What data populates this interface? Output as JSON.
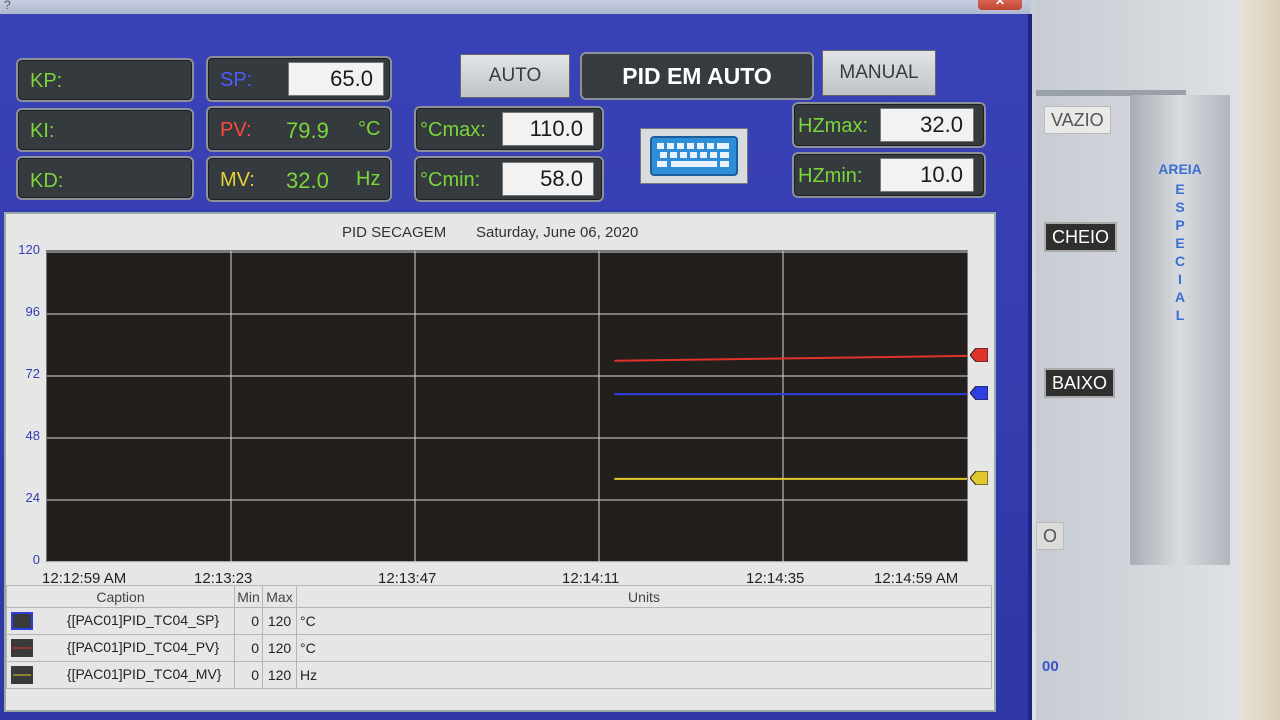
{
  "window": {
    "title_mark": "?",
    "close_glyph": "✕"
  },
  "controls": {
    "kp_label": "KP:",
    "ki_label": "KI:",
    "kd_label": "KD:",
    "sp_label": "SP:",
    "sp_value": "65.0",
    "pv_label": "PV:",
    "pv_value": "79.9",
    "pv_unit": "°C",
    "mv_label": "MV:",
    "mv_value": "32.0",
    "mv_unit": "Hz",
    "cmax_label": "°Cmax:",
    "cmax_value": "110.0",
    "cmin_label": "°Cmin:",
    "cmin_value": "58.0",
    "hzmax_label": "HZmax:",
    "hzmax_value": "32.0",
    "hzmin_label": "HZmin:",
    "hzmin_value": "10.0",
    "auto_button": "AUTO",
    "mode_status": "PID EM AUTO",
    "manual_button": "MANUAL",
    "keyboard_icon": "keyboard-icon"
  },
  "trend": {
    "title": "PID SECAGEM",
    "date": "Saturday, June 06, 2020",
    "legend_headers": {
      "caption": "Caption",
      "min": "Min",
      "max": "Max",
      "units": "Units"
    },
    "legend_rows": [
      {
        "caption": "{[PAC01]PID_TC04_SP}",
        "min": "0",
        "max": "120",
        "unit": "°C",
        "color": "#2d3fe0"
      },
      {
        "caption": "{[PAC01]PID_TC04_PV}",
        "min": "0",
        "max": "120",
        "unit": "°C",
        "color": "#e0332b"
      },
      {
        "caption": "{[PAC01]PID_TC04_MV}",
        "min": "0",
        "max": "120",
        "unit": "Hz",
        "color": "#e0c82b"
      }
    ]
  },
  "chart_data": {
    "type": "line",
    "title": "PID SECAGEM",
    "subtitle": "Saturday, June 06, 2020",
    "y_ticks": [
      "120",
      "96",
      "72",
      "48",
      "24",
      "0"
    ],
    "x_ticks": [
      "12:12:59 AM",
      "12:13:23",
      "12:13:47",
      "12:14:11",
      "12:14:35",
      "12:14:59 AM"
    ],
    "ylim": [
      0,
      120
    ],
    "xlim": [
      "12:12:59",
      "12:14:59"
    ],
    "grid": true,
    "series": [
      {
        "name": "{[PAC01]PID_TC04_PV}",
        "color": "#e0332b",
        "x": [
          "12:14:13",
          "12:14:59"
        ],
        "values": [
          78,
          79.9
        ]
      },
      {
        "name": "{[PAC01]PID_TC04_SP}",
        "color": "#2d3fe0",
        "x": [
          "12:14:13",
          "12:14:59"
        ],
        "values": [
          65,
          65
        ]
      },
      {
        "name": "{[PAC01]PID_TC04_MV}",
        "color": "#e0c82b",
        "x": [
          "12:14:13",
          "12:14:59"
        ],
        "values": [
          32,
          32
        ]
      }
    ]
  },
  "side": {
    "vazio": "VAZIO",
    "cheio": "CHEIO",
    "baixo": "BAIXO",
    "silo_label": "AREIA",
    "silo_letters": [
      "E",
      "S",
      "P",
      "E",
      "C",
      "I",
      "A",
      "L"
    ],
    "partial_o": "O",
    "partial_00": "00"
  }
}
